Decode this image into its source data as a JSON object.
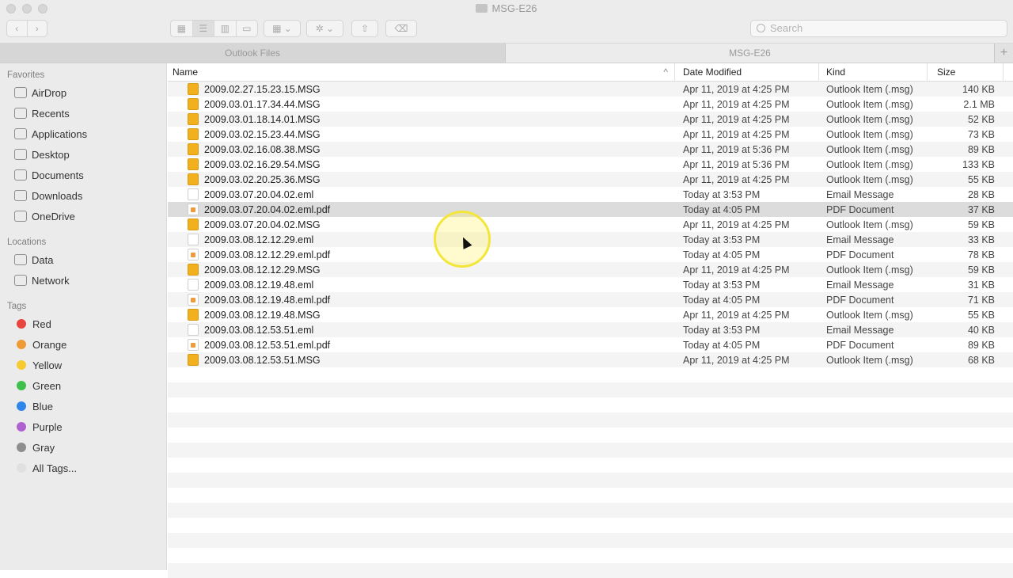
{
  "window": {
    "title": "MSG-E26"
  },
  "toolbar": {
    "search_placeholder": "Search"
  },
  "tabs": [
    {
      "label": "Outlook Files"
    },
    {
      "label": "MSG-E26"
    }
  ],
  "sidebar": {
    "favorites_label": "Favorites",
    "favorites": [
      {
        "label": "AirDrop"
      },
      {
        "label": "Recents"
      },
      {
        "label": "Applications"
      },
      {
        "label": "Desktop"
      },
      {
        "label": "Documents"
      },
      {
        "label": "Downloads"
      },
      {
        "label": "OneDrive"
      }
    ],
    "locations_label": "Locations",
    "locations": [
      {
        "label": "Data"
      },
      {
        "label": "Network"
      }
    ],
    "tags_label": "Tags",
    "tags": [
      {
        "label": "Red",
        "color": "#e9443d"
      },
      {
        "label": "Orange",
        "color": "#f09a35"
      },
      {
        "label": "Yellow",
        "color": "#f5cb2f"
      },
      {
        "label": "Green",
        "color": "#3fc04c"
      },
      {
        "label": "Blue",
        "color": "#2f86ea"
      },
      {
        "label": "Purple",
        "color": "#b061d1"
      },
      {
        "label": "Gray",
        "color": "#8e8e8e"
      },
      {
        "label": "All Tags...",
        "color": "#e0e0e0"
      }
    ]
  },
  "columns": {
    "name": "Name",
    "date": "Date Modified",
    "kind": "Kind",
    "size": "Size"
  },
  "files": [
    {
      "name": "2009.02.27.15.23.15.MSG",
      "date": "Apr 11, 2019 at 4:25 PM",
      "kind": "Outlook Item (.msg)",
      "size": "140 KB",
      "type": "msg"
    },
    {
      "name": "2009.03.01.17.34.44.MSG",
      "date": "Apr 11, 2019 at 4:25 PM",
      "kind": "Outlook Item (.msg)",
      "size": "2.1 MB",
      "type": "msg"
    },
    {
      "name": "2009.03.01.18.14.01.MSG",
      "date": "Apr 11, 2019 at 4:25 PM",
      "kind": "Outlook Item (.msg)",
      "size": "52 KB",
      "type": "msg"
    },
    {
      "name": "2009.03.02.15.23.44.MSG",
      "date": "Apr 11, 2019 at 4:25 PM",
      "kind": "Outlook Item (.msg)",
      "size": "73 KB",
      "type": "msg"
    },
    {
      "name": "2009.03.02.16.08.38.MSG",
      "date": "Apr 11, 2019 at 5:36 PM",
      "kind": "Outlook Item (.msg)",
      "size": "89 KB",
      "type": "msg"
    },
    {
      "name": "2009.03.02.16.29.54.MSG",
      "date": "Apr 11, 2019 at 5:36 PM",
      "kind": "Outlook Item (.msg)",
      "size": "133 KB",
      "type": "msg"
    },
    {
      "name": "2009.03.02.20.25.36.MSG",
      "date": "Apr 11, 2019 at 4:25 PM",
      "kind": "Outlook Item (.msg)",
      "size": "55 KB",
      "type": "msg"
    },
    {
      "name": "2009.03.07.20.04.02.eml",
      "date": "Today at 3:53 PM",
      "kind": "Email Message",
      "size": "28 KB",
      "type": "eml"
    },
    {
      "name": "2009.03.07.20.04.02.eml.pdf",
      "date": "Today at 4:05 PM",
      "kind": "PDF Document",
      "size": "37 KB",
      "type": "pdf",
      "selected": true
    },
    {
      "name": "2009.03.07.20.04.02.MSG",
      "date": "Apr 11, 2019 at 4:25 PM",
      "kind": "Outlook Item (.msg)",
      "size": "59 KB",
      "type": "msg"
    },
    {
      "name": "2009.03.08.12.12.29.eml",
      "date": "Today at 3:53 PM",
      "kind": "Email Message",
      "size": "33 KB",
      "type": "eml"
    },
    {
      "name": "2009.03.08.12.12.29.eml.pdf",
      "date": "Today at 4:05 PM",
      "kind": "PDF Document",
      "size": "78 KB",
      "type": "pdf"
    },
    {
      "name": "2009.03.08.12.12.29.MSG",
      "date": "Apr 11, 2019 at 4:25 PM",
      "kind": "Outlook Item (.msg)",
      "size": "59 KB",
      "type": "msg"
    },
    {
      "name": "2009.03.08.12.19.48.eml",
      "date": "Today at 3:53 PM",
      "kind": "Email Message",
      "size": "31 KB",
      "type": "eml"
    },
    {
      "name": "2009.03.08.12.19.48.eml.pdf",
      "date": "Today at 4:05 PM",
      "kind": "PDF Document",
      "size": "71 KB",
      "type": "pdf"
    },
    {
      "name": "2009.03.08.12.19.48.MSG",
      "date": "Apr 11, 2019 at 4:25 PM",
      "kind": "Outlook Item (.msg)",
      "size": "55 KB",
      "type": "msg"
    },
    {
      "name": "2009.03.08.12.53.51.eml",
      "date": "Today at 3:53 PM",
      "kind": "Email Message",
      "size": "40 KB",
      "type": "eml"
    },
    {
      "name": "2009.03.08.12.53.51.eml.pdf",
      "date": "Today at 4:05 PM",
      "kind": "PDF Document",
      "size": "89 KB",
      "type": "pdf"
    },
    {
      "name": "2009.03.08.12.53.51.MSG",
      "date": "Apr 11, 2019 at 4:25 PM",
      "kind": "Outlook Item (.msg)",
      "size": "68 KB",
      "type": "msg"
    }
  ]
}
